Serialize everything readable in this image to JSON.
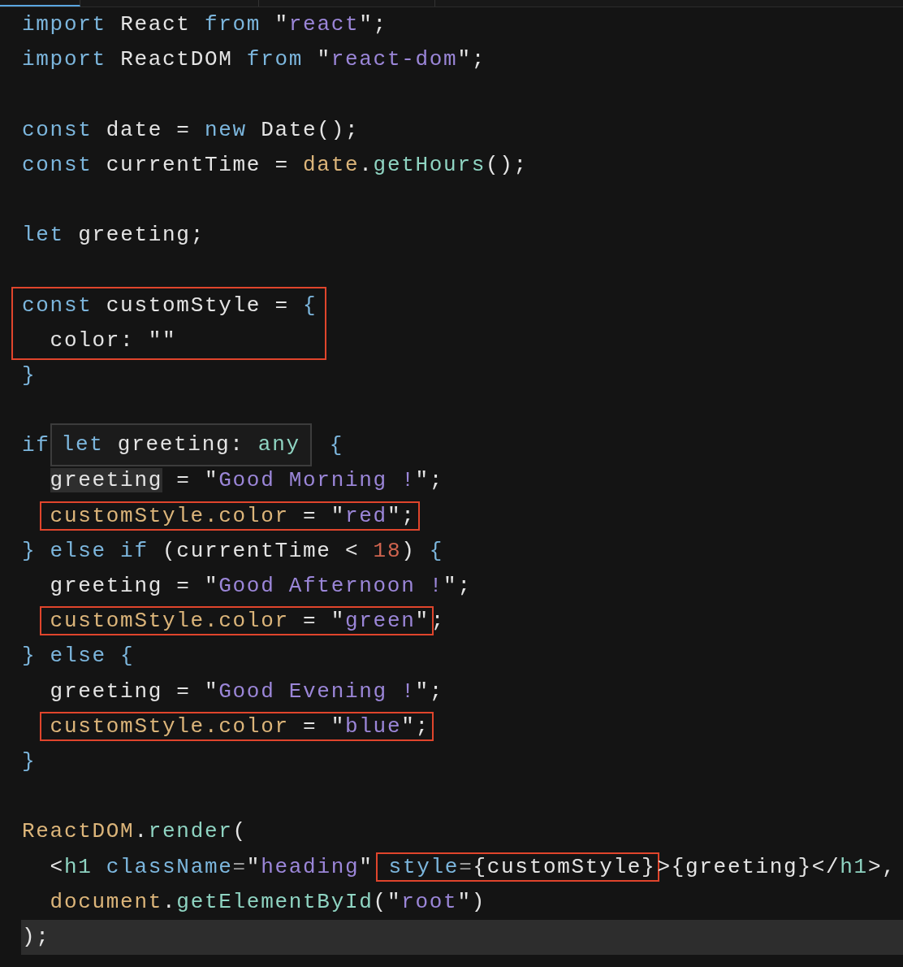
{
  "tabs": [
    {
      "selected": true
    },
    {
      "selected": false
    },
    {
      "selected": false
    }
  ],
  "lines": [
    {
      "kind": "line",
      "segments": [
        {
          "kind": "kw",
          "text": "import"
        },
        {
          "kind": "plain",
          "text": " React "
        },
        {
          "kind": "kw",
          "text": "from"
        },
        {
          "kind": "plain",
          "text": " \""
        },
        {
          "kind": "str",
          "text": "react"
        },
        {
          "kind": "plain",
          "text": "\";"
        }
      ]
    },
    {
      "kind": "line",
      "segments": [
        {
          "kind": "kw",
          "text": "import"
        },
        {
          "kind": "plain",
          "text": " ReactDOM "
        },
        {
          "kind": "kw",
          "text": "from"
        },
        {
          "kind": "plain",
          "text": " \""
        },
        {
          "kind": "str",
          "text": "react-dom"
        },
        {
          "kind": "plain",
          "text": "\";"
        }
      ]
    },
    {
      "kind": "line"
    },
    {
      "kind": "line",
      "segments": [
        {
          "kind": "kw",
          "text": "const"
        },
        {
          "kind": "plain",
          "text": " date = "
        },
        {
          "kind": "kw",
          "text": "new"
        },
        {
          "kind": "plain",
          "text": " Date();"
        }
      ]
    },
    {
      "kind": "line",
      "segments": [
        {
          "kind": "kw",
          "text": "const"
        },
        {
          "kind": "plain",
          "text": " currentTime = "
        },
        {
          "kind": "obj",
          "text": "date"
        },
        {
          "kind": "plain",
          "text": "."
        },
        {
          "kind": "fn",
          "text": "getHours"
        },
        {
          "kind": "plain",
          "text": "();"
        }
      ]
    },
    {
      "kind": "line"
    },
    {
      "kind": "line",
      "segments": [
        {
          "kind": "kw",
          "text": "let"
        },
        {
          "kind": "plain",
          "text": " greeting;"
        }
      ]
    },
    {
      "kind": "line"
    },
    {
      "kind": "box",
      "lines": [
        {
          "kind": "line",
          "segments": [
            {
              "kind": "kw",
              "text": "const"
            },
            {
              "kind": "plain",
              "text": " customStyle = "
            },
            {
              "kind": "kw",
              "text": "{"
            }
          ]
        },
        {
          "kind": "indented",
          "segments": [
            {
              "kind": "plain",
              "text": "color: \"\""
            }
          ]
        }
      ]
    },
    {
      "kind": "line",
      "segments": [
        {
          "kind": "kw",
          "text": "}"
        }
      ]
    },
    {
      "kind": "line"
    },
    {
      "kind": "line",
      "segments": [
        {
          "kind": "kw",
          "text": "if"
        },
        {
          "kind": "hover",
          "segments": [
            {
              "kind": "kw",
              "text": "let"
            },
            {
              "kind": "plain",
              "text": " greeting: "
            },
            {
              "kind": "fn",
              "text": "any"
            }
          ]
        },
        {
          "kind": "kw",
          "text": "{"
        }
      ]
    },
    {
      "kind": "indented",
      "segments": [
        {
          "kind": "hl",
          "text": "greeting"
        },
        {
          "kind": "plain",
          "text": " = \""
        },
        {
          "kind": "str",
          "text": "Good Morning !"
        },
        {
          "kind": "plain",
          "text": "\";"
        }
      ]
    },
    {
      "kind": "indented",
      "segments": [
        {
          "kind": "box",
          "segments": [
            {
              "kind": "obj",
              "text": "customStyle.color"
            },
            {
              "kind": "plain",
              "text": " = \""
            },
            {
              "kind": "str",
              "text": "red"
            },
            {
              "kind": "plain",
              "text": "\";"
            }
          ]
        }
      ]
    },
    {
      "kind": "line",
      "segments": [
        {
          "kind": "kw",
          "text": "} "
        },
        {
          "kind": "kw",
          "text": "else if"
        },
        {
          "kind": "plain",
          "text": " (currentTime < "
        },
        {
          "kind": "num",
          "text": "18"
        },
        {
          "kind": "plain",
          "text": ") "
        },
        {
          "kind": "kw",
          "text": "{"
        }
      ]
    },
    {
      "kind": "indented",
      "segments": [
        {
          "kind": "plain",
          "text": "greeting = \""
        },
        {
          "kind": "str",
          "text": "Good Afternoon !"
        },
        {
          "kind": "plain",
          "text": "\";"
        }
      ]
    },
    {
      "kind": "indented",
      "segments": [
        {
          "kind": "box",
          "segments": [
            {
              "kind": "obj",
              "text": "customStyle.color"
            },
            {
              "kind": "plain",
              "text": " = \""
            },
            {
              "kind": "str",
              "text": "green"
            },
            {
              "kind": "plain",
              "text": "\""
            }
          ]
        },
        {
          "kind": "plain",
          "text": ";"
        }
      ]
    },
    {
      "kind": "line",
      "segments": [
        {
          "kind": "kw",
          "text": "} else {"
        }
      ]
    },
    {
      "kind": "indented",
      "segments": [
        {
          "kind": "plain",
          "text": "greeting = \""
        },
        {
          "kind": "str",
          "text": "Good Evening !"
        },
        {
          "kind": "plain",
          "text": "\";"
        }
      ]
    },
    {
      "kind": "indented",
      "segments": [
        {
          "kind": "box",
          "segments": [
            {
              "kind": "obj",
              "text": "customStyle.color"
            },
            {
              "kind": "plain",
              "text": " = \""
            },
            {
              "kind": "str",
              "text": "blue"
            },
            {
              "kind": "plain",
              "text": "\";"
            }
          ]
        }
      ]
    },
    {
      "kind": "line",
      "segments": [
        {
          "kind": "kw",
          "text": "}"
        }
      ]
    },
    {
      "kind": "line"
    },
    {
      "kind": "line",
      "segments": [
        {
          "kind": "obj",
          "text": "ReactDOM"
        },
        {
          "kind": "plain",
          "text": "."
        },
        {
          "kind": "fn",
          "text": "render"
        },
        {
          "kind": "plain",
          "text": "("
        }
      ]
    },
    {
      "kind": "indented",
      "segments": [
        {
          "kind": "plain",
          "text": "<"
        },
        {
          "kind": "fn",
          "text": "h1"
        },
        {
          "kind": "kw",
          "text": " className"
        },
        {
          "kind": "op",
          "text": "="
        },
        {
          "kind": "plain",
          "text": "\""
        },
        {
          "kind": "str",
          "text": "heading"
        },
        {
          "kind": "plain",
          "text": "\""
        },
        {
          "kind": "box",
          "segments": [
            {
              "kind": "kw",
              "text": "style"
            },
            {
              "kind": "op",
              "text": "="
            },
            {
              "kind": "plain",
              "text": "{customStyle}"
            }
          ]
        },
        {
          "kind": "plain",
          "text": ">{greeting}</"
        },
        {
          "kind": "fn",
          "text": "h1"
        },
        {
          "kind": "plain",
          "text": ">,"
        }
      ]
    },
    {
      "kind": "indented",
      "segments": [
        {
          "kind": "obj",
          "text": "document"
        },
        {
          "kind": "plain",
          "text": "."
        },
        {
          "kind": "fn",
          "text": "getElementById"
        },
        {
          "kind": "plain",
          "text": "(\""
        },
        {
          "kind": "str",
          "text": "root"
        },
        {
          "kind": "plain",
          "text": "\")"
        }
      ]
    },
    {
      "kind": "current",
      "segments": [
        {
          "kind": "plain",
          "text": ");"
        }
      ]
    }
  ]
}
